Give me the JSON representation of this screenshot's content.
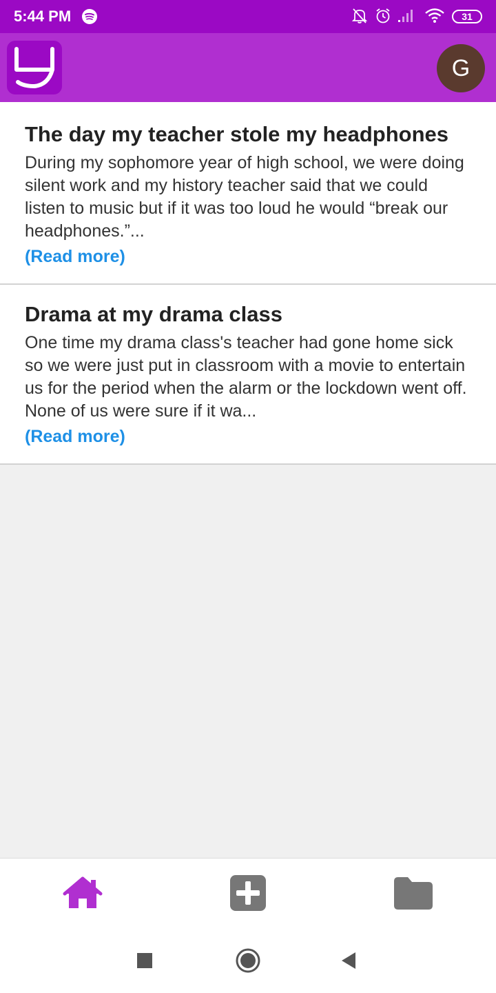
{
  "status_bar": {
    "time": "5:44 PM",
    "battery": "31",
    "icons": [
      "spotify-icon",
      "mute-bell-icon",
      "alarm-icon",
      "signal-icon",
      "wifi-icon",
      "battery-icon"
    ]
  },
  "app_bar": {
    "logo": "app-logo",
    "avatar_letter": "G"
  },
  "feed": {
    "posts": [
      {
        "title": "The day my teacher stole my headphones",
        "excerpt": "During my sophomore year of high school, we were doing silent work and my history teacher said that we could listen to music but if it was too loud he would “break our headphones.”...",
        "read_more": "(Read more)"
      },
      {
        "title": "Drama at my drama class",
        "excerpt": "One time my drama class's teacher had gone home sick so we were just put in classroom with a movie to entertain us for the period when the alarm or the lockdown went off.\nNone of us were sure if it wa...",
        "read_more": "(Read more)"
      }
    ]
  },
  "bottom_nav": {
    "items": [
      {
        "icon": "home-icon",
        "active": true
      },
      {
        "icon": "add-icon",
        "active": false
      },
      {
        "icon": "folder-icon",
        "active": false
      }
    ],
    "active_color": "#b02fd0",
    "inactive_color": "#777777"
  },
  "system_nav": [
    "recents-icon",
    "home-circle-icon",
    "back-icon"
  ],
  "colors": {
    "status_bar": "#9b09c4",
    "app_bar": "#b02fd0",
    "link": "#1e90e6",
    "avatar": "#5a3a2e"
  }
}
